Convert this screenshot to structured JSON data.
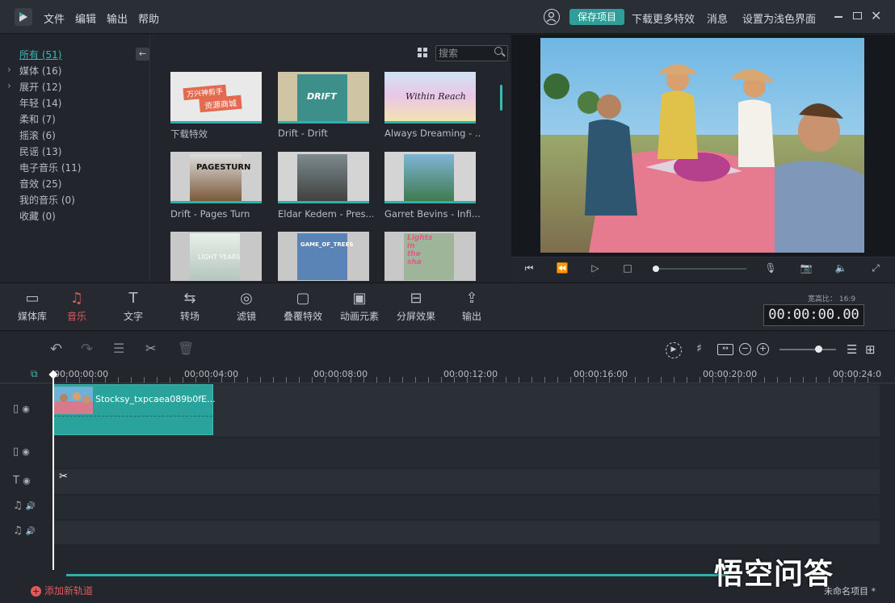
{
  "menu": [
    "文件",
    "编辑",
    "输出",
    "帮助"
  ],
  "topbar": {
    "save": "保存项目",
    "download": "下载更多特效",
    "message": "消息",
    "theme": "设置为浅色界面"
  },
  "categories": [
    {
      "label": "所有 (51)",
      "active": true
    },
    {
      "label": "媒体 (16)",
      "arrow": true
    },
    {
      "label": "展开 (12)",
      "arrow": true
    },
    {
      "label": "年轻 (14)"
    },
    {
      "label": "柔和 (7)"
    },
    {
      "label": "摇滚 (6)"
    },
    {
      "label": "民谣 (13)"
    },
    {
      "label": "电子音乐 (11)"
    },
    {
      "label": "音效 (25)"
    },
    {
      "label": "我的音乐 (0)"
    },
    {
      "label": "收藏 (0)"
    }
  ],
  "search": {
    "placeholder": "搜索"
  },
  "media": [
    {
      "label": "下载特效",
      "art": [
        "万兴神剪手",
        "资源商城"
      ]
    },
    {
      "label": "Drift - Drift",
      "art": [
        "DRIFT"
      ]
    },
    {
      "label": "Always Dreaming - ...",
      "art": [
        "Within Reach"
      ]
    },
    {
      "label": "Drift - Pages Turn",
      "art": [
        "PAGESTURN"
      ]
    },
    {
      "label": "Eldar Kedem - Pres...",
      "art": []
    },
    {
      "label": "Garret Bevins - Infi...",
      "art": []
    },
    {
      "label": "",
      "art": [
        "LIGHT YEARS"
      ]
    },
    {
      "label": "",
      "art": [
        "GAME_OF_TREES"
      ]
    },
    {
      "label": "",
      "art": [
        "Lights",
        "in",
        "the",
        "sha"
      ]
    }
  ],
  "tools": [
    {
      "label": "媒体库",
      "icon": "folder-icon",
      "glyph": "▭"
    },
    {
      "label": "音乐",
      "icon": "music-icon",
      "glyph": "♫",
      "active": true
    },
    {
      "label": "文字",
      "icon": "text-icon",
      "glyph": "T"
    },
    {
      "label": "转场",
      "icon": "transition-icon",
      "glyph": "⇆"
    },
    {
      "label": "滤镜",
      "icon": "filter-icon",
      "glyph": "◎"
    },
    {
      "label": "叠覆特效",
      "icon": "overlay-icon",
      "glyph": "▢"
    },
    {
      "label": "动画元素",
      "icon": "element-icon",
      "glyph": "▣"
    },
    {
      "label": "分屏效果",
      "icon": "splitscreen-icon",
      "glyph": "⊟"
    },
    {
      "label": "输出",
      "icon": "export-icon",
      "glyph": "⇪"
    }
  ],
  "aspect": "宽高比： 16:9",
  "timecode": "00:00:00.00",
  "ruler": [
    "00:00:00:00",
    "00:00:04:00",
    "00:00:08:00",
    "00:00:12:00",
    "00:00:16:00",
    "00:00:20:00",
    "00:00:24:0"
  ],
  "clip": {
    "name": "Stocksy_txpcaea089b0fE..."
  },
  "footer": {
    "add_track": "添加新轨道",
    "project": "未命名项目 *"
  },
  "watermark": "悟空问答",
  "colors": {
    "accent": "#2fb0a9",
    "active_tool": "#e05a5a",
    "background": "#1f2329"
  }
}
